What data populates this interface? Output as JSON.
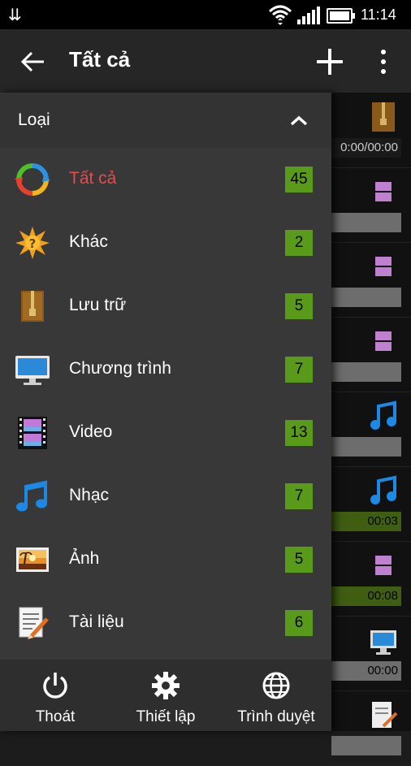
{
  "status_bar": {
    "time": "11:14"
  },
  "app_bar": {
    "title": "Tất cả"
  },
  "drawer": {
    "section_label": "Loại",
    "categories": [
      {
        "name": "Tất cả",
        "count": "45",
        "icon": "refresh-arrows-icon",
        "active": true
      },
      {
        "name": "Khác",
        "count": "2",
        "icon": "question-star-icon"
      },
      {
        "name": "Lưu trữ",
        "count": "5",
        "icon": "archive-icon"
      },
      {
        "name": "Chương trình",
        "count": "7",
        "icon": "monitor-icon"
      },
      {
        "name": "Video",
        "count": "13",
        "icon": "video-film-icon"
      },
      {
        "name": "Nhạc",
        "count": "7",
        "icon": "music-note-icon"
      },
      {
        "name": "Ảnh",
        "count": "5",
        "icon": "photo-icon"
      },
      {
        "name": "Tài liệu",
        "count": "6",
        "icon": "document-icon"
      }
    ],
    "bottom": [
      {
        "label": "Thoát",
        "icon": "power-icon"
      },
      {
        "label": "Thiết lập",
        "icon": "gear-icon"
      },
      {
        "label": "Trình duyệt",
        "icon": "globe-icon"
      }
    ]
  },
  "background_list": [
    {
      "icon": "archive-icon",
      "progress_text": "0:00/00:00"
    },
    {
      "icon": "video-film-icon",
      "progress_text": ""
    },
    {
      "icon": "video-film-icon",
      "progress_text": ""
    },
    {
      "icon": "video-film-icon",
      "progress_text": ""
    },
    {
      "icon": "music-note-icon",
      "progress_text": ""
    },
    {
      "icon": "music-note-icon",
      "progress_text": "00:03"
    },
    {
      "icon": "video-film-icon",
      "progress_text": "00:08"
    },
    {
      "icon": "monitor-icon",
      "progress_text": "00:00"
    },
    {
      "icon": "document-icon",
      "progress_text": ""
    }
  ],
  "colors": {
    "accent_active": "#e84b4b",
    "badge_green": "#5a9a1a"
  }
}
